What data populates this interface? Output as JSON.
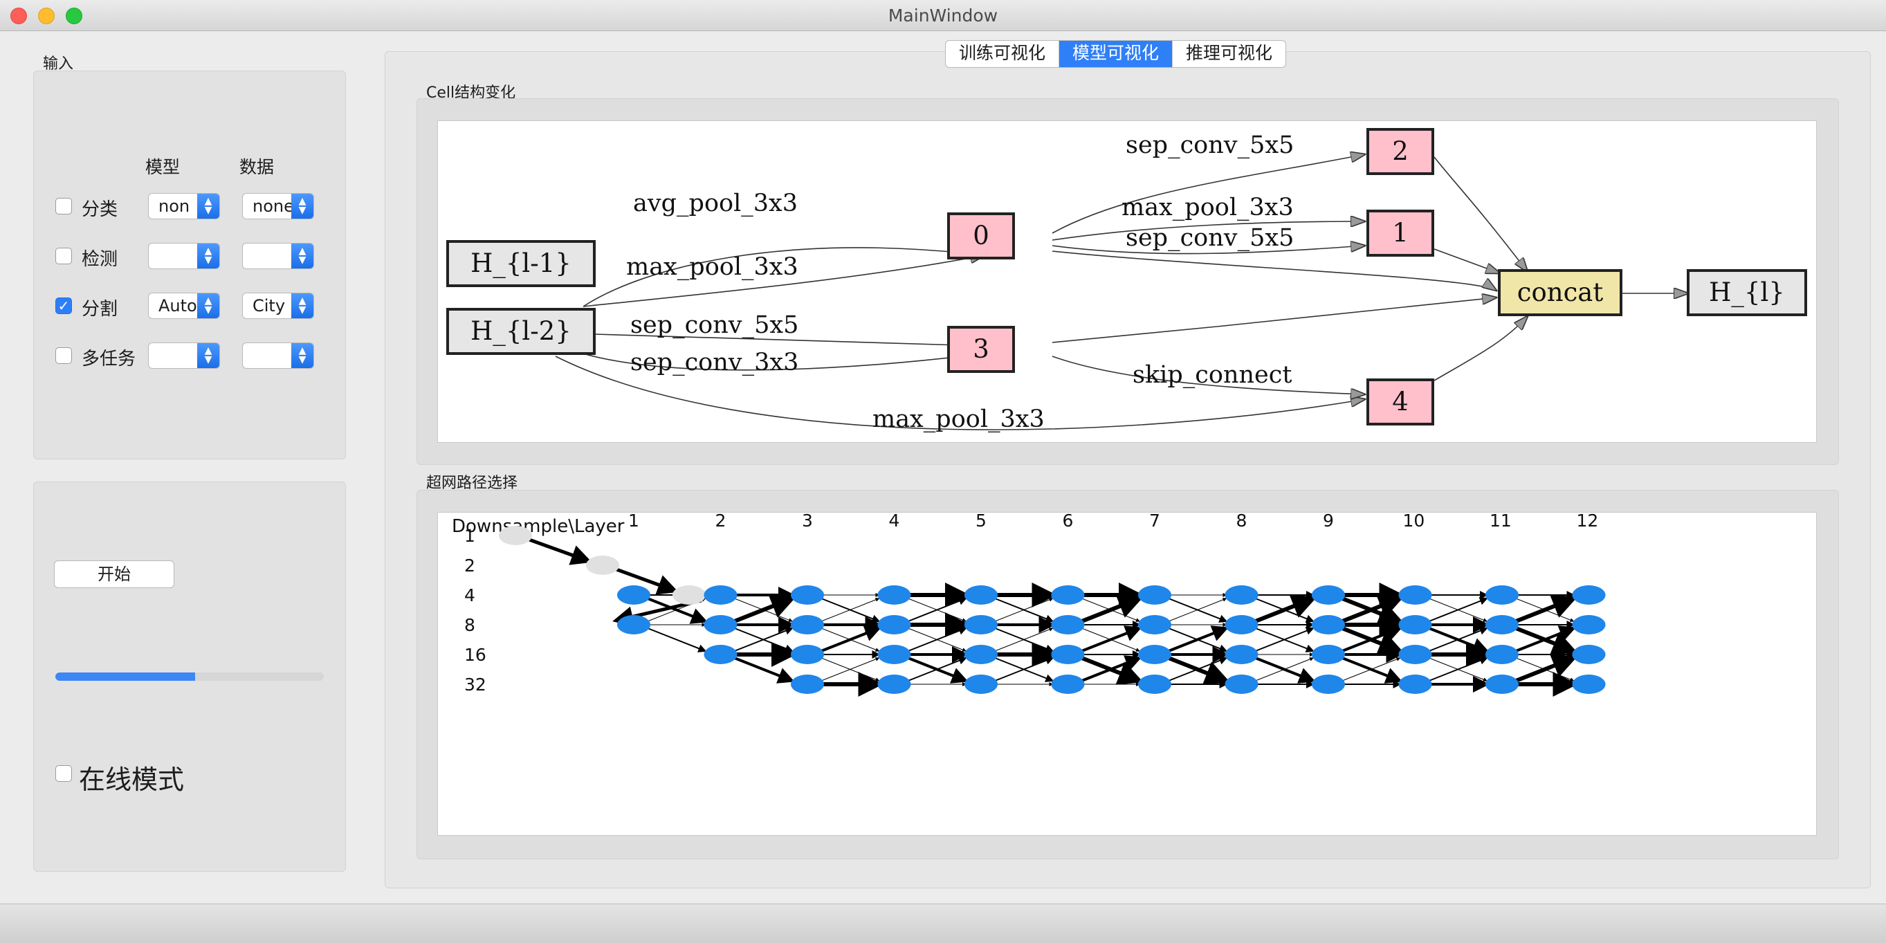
{
  "window": {
    "title": "MainWindow"
  },
  "input_group": {
    "title": "输入",
    "col_model": "模型",
    "col_data": "数据",
    "rows": [
      {
        "label": "分类",
        "checked": false,
        "model": "non",
        "data": "none"
      },
      {
        "label": "检测",
        "checked": false,
        "model": "",
        "data": ""
      },
      {
        "label": "分割",
        "checked": true,
        "model": "Auto",
        "data": "City"
      },
      {
        "label": "多任务",
        "checked": false,
        "model": "",
        "data": ""
      }
    ]
  },
  "control_group": {
    "start_label": "开始",
    "progress_fraction": 0.52,
    "online_label": "在线模式",
    "online_checked": false
  },
  "tabs": [
    {
      "label": "训练可视化",
      "active": false
    },
    {
      "label": "模型可视化",
      "active": true
    },
    {
      "label": "推理可视化",
      "active": false
    }
  ],
  "cell_section": {
    "title": "Cell结构变化",
    "nodes": {
      "h_prev1": "H_{l-1}",
      "h_prev2": "H_{l-2}",
      "n0": "0",
      "n1": "1",
      "n2": "2",
      "n3": "3",
      "n4": "4",
      "concat": "concat",
      "h_out": "H_{l}"
    },
    "edges": [
      {
        "from": "H_{l-2}",
        "to": "0",
        "op": "avg_pool_3x3"
      },
      {
        "from": "H_{l-2}",
        "to": "0",
        "op": "max_pool_3x3"
      },
      {
        "from": "H_{l-2}",
        "to": "3",
        "op": "sep_conv_5x5"
      },
      {
        "from": "H_{l-2}",
        "to": "3",
        "op": "sep_conv_3x3"
      },
      {
        "from": "H_{l-2}",
        "to": "4",
        "op": "max_pool_3x3"
      },
      {
        "from": "0",
        "to": "2",
        "op": "sep_conv_5x5"
      },
      {
        "from": "0",
        "to": "1",
        "op": "max_pool_3x3"
      },
      {
        "from": "0",
        "to": "1",
        "op": "sep_conv_5x5"
      },
      {
        "from": "3",
        "to": "4",
        "op": "skip_connect"
      }
    ],
    "colors": {
      "intermediate": "#ffc0cb",
      "concat": "#f0e6a8",
      "input": "#e6e6e6"
    }
  },
  "supernet_section": {
    "title": "超网路径选择",
    "corner_label": "Downsample\\Layer",
    "layers": [
      "1",
      "2",
      "3",
      "4",
      "5",
      "6",
      "7",
      "8",
      "9",
      "10",
      "11",
      "12"
    ],
    "downsample": [
      "1",
      "2",
      "4",
      "8",
      "16",
      "32"
    ],
    "colors": {
      "active_node": "#1f86ea",
      "stem_node": "#e0e0e0"
    }
  }
}
